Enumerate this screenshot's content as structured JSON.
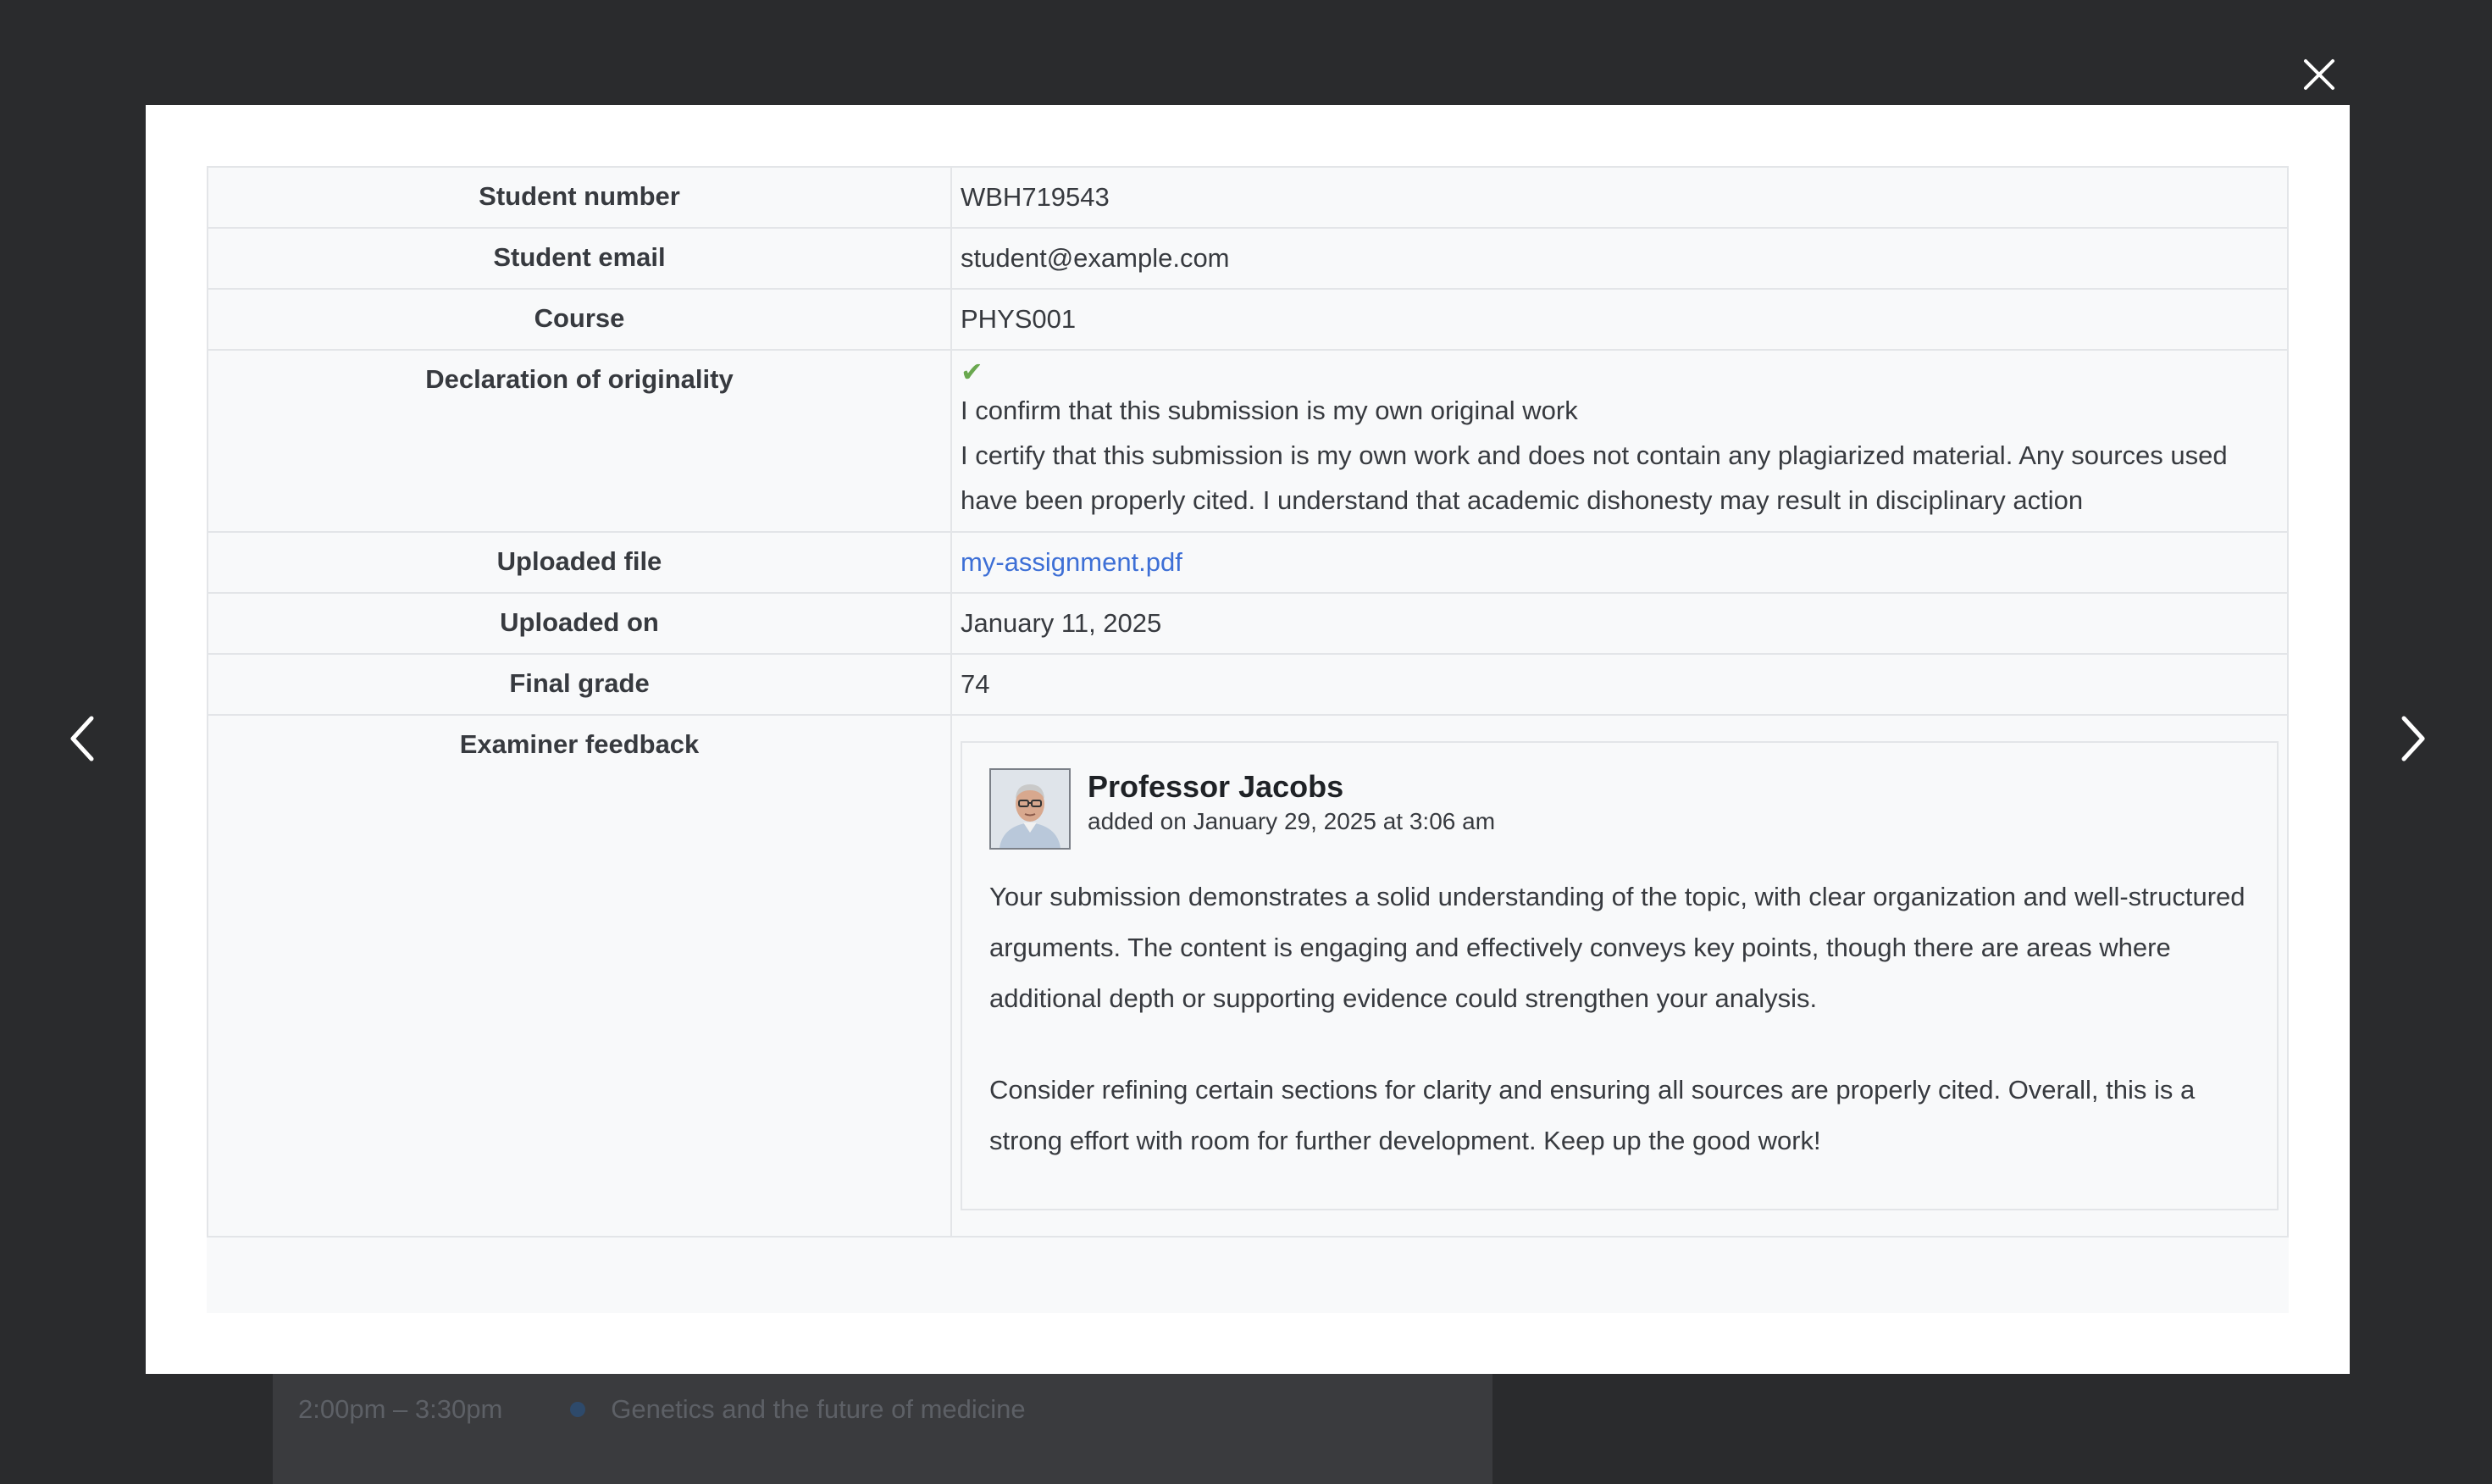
{
  "background": {
    "schedule_time": "2:00pm – 3:30pm",
    "schedule_title": "Genetics and the future of medicine"
  },
  "icons": {
    "close": "close-icon",
    "prev": "chevron-left-icon",
    "next": "chevron-right-icon",
    "check": "checkmark-icon"
  },
  "details": {
    "student_number_label": "Student number",
    "student_number": "WBH719543",
    "student_email_label": "Student email",
    "student_email": "student@example.com",
    "course_label": "Course",
    "course": "PHYS001",
    "declaration_label": "Declaration of originality",
    "declaration_check": "✔",
    "declaration_confirm": "I confirm that this submission is my own original work",
    "declaration_text": "I certify that this submission is my own work and does not contain any plagiarized material. Any sources used have been properly cited. I understand that academic dishonesty may result in disciplinary action",
    "uploaded_file_label": "Uploaded file",
    "uploaded_file": "my-assignment.pdf",
    "uploaded_on_label": "Uploaded on",
    "uploaded_on": "January 11, 2025",
    "final_grade_label": "Final grade",
    "final_grade": "74",
    "feedback_label": "Examiner feedback"
  },
  "feedback": {
    "author": "Professor Jacobs",
    "date": "added on January 29, 2025 at 3:06 am",
    "paragraph1": "Your submission demonstrates a solid understanding of the topic, with clear organization and well-structured arguments. The content is engaging and effectively conveys key points, though there are areas where additional depth or supporting evidence could strengthen your analysis.",
    "paragraph2": "Consider refining certain sections for clarity and ensuring all sources are properly cited. Overall, this is a strong effort with room for further development. Keep up the good work!"
  },
  "colors": {
    "overlay": "#2a2b2d",
    "link": "#3d6fd6",
    "check": "#6aa84f",
    "table_bg": "#f8f9fa"
  }
}
